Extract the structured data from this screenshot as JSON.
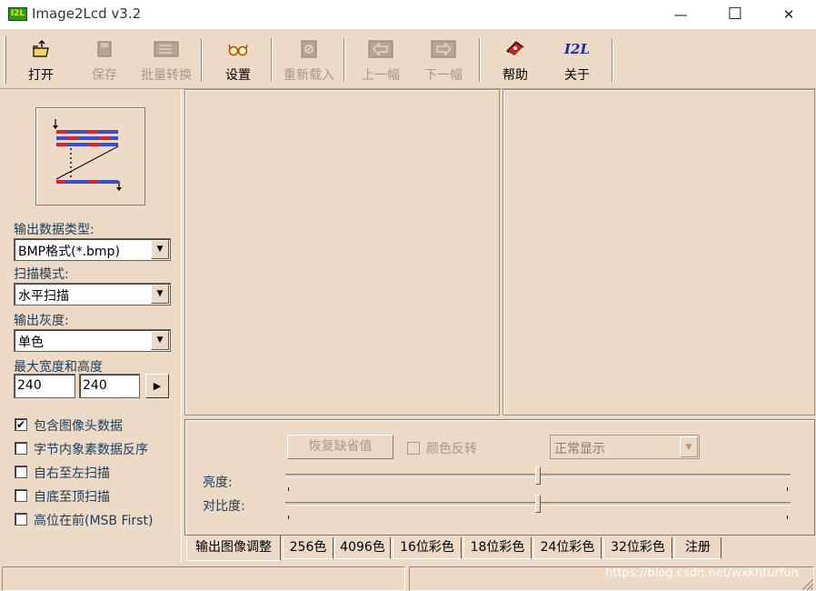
{
  "window": {
    "app_icon_text": "I2L",
    "title": "Image2Lcd v3.2",
    "minimize_glyph": "—",
    "maximize_glyph": "☐",
    "close_glyph": "✕"
  },
  "toolbar": {
    "items": [
      {
        "label": "打开",
        "icon": "open-folder-icon",
        "enabled": true
      },
      {
        "label": "保存",
        "icon": "save-disk-icon",
        "enabled": false
      },
      {
        "label": "批量转换",
        "icon": "batch-convert-icon",
        "enabled": false
      },
      {
        "label": "设置",
        "icon": "glasses-icon",
        "enabled": true
      },
      {
        "label": "重新载入",
        "icon": "reload-icon",
        "enabled": false
      },
      {
        "label": "上一幅",
        "icon": "previous-arrow-icon",
        "enabled": false
      },
      {
        "label": "下一幅",
        "icon": "next-arrow-icon",
        "enabled": false
      },
      {
        "label": "帮助",
        "icon": "help-book-icon",
        "enabled": true
      },
      {
        "label": "关于",
        "icon": "about-logo-icon",
        "enabled": true
      }
    ],
    "about_logo_text": "I2L"
  },
  "settings": {
    "output_type_label": "输出数据类型:",
    "output_type_value": "BMP格式(*.bmp)",
    "scan_mode_label": "扫描模式:",
    "scan_mode_value": "水平扫描",
    "gray_label": "输出灰度:",
    "gray_value": "单色",
    "max_size_label": "最大宽度和高度",
    "max_width": "240",
    "max_height": "240",
    "options": [
      {
        "label": "包含图像头数据",
        "checked": true
      },
      {
        "label": "字节内象素数据反序",
        "checked": false
      },
      {
        "label": "自右至左扫描",
        "checked": false
      },
      {
        "label": "自底至顶扫描",
        "checked": false
      },
      {
        "label": "高位在前(MSB First)",
        "checked": false
      }
    ]
  },
  "adjust": {
    "restore_button": "恢复缺省值",
    "invert_label": "颜色反转",
    "invert_checked": false,
    "display_mode_value": "正常显示",
    "brightness_label": "亮度:",
    "brightness_level": 0.5,
    "contrast_label": "对比度:",
    "contrast_level": 0.5
  },
  "tabs": [
    "输出图像调整",
    "256色",
    "4096色",
    "16位彩色",
    "18位彩色",
    "24位彩色",
    "32位彩色",
    "注册"
  ],
  "active_tab": 0,
  "watermark": "https://blog.csdn.net/wxkhturfun",
  "colors": {
    "background": "#ecd9c6",
    "label_text": "#1a3d5c",
    "disabled_text": "#a99885"
  }
}
